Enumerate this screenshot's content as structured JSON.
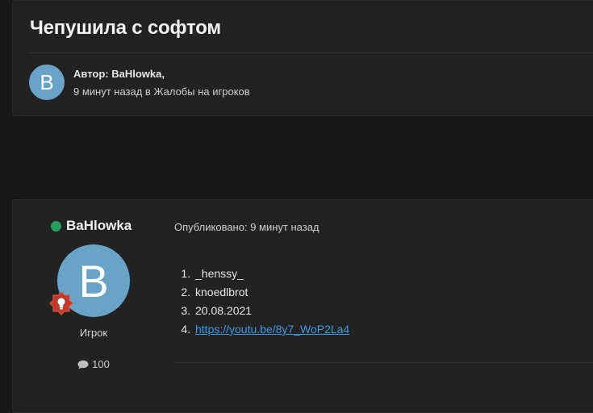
{
  "topic": {
    "title": "Чепушила с софтом",
    "author_line": "Автор: BaHlowka,",
    "sub_line": "9 минут назад в Жалобы на игроков",
    "avatar_letter": "B"
  },
  "post": {
    "author": "BaHlowka",
    "avatar_letter": "B",
    "rank": "Игрок",
    "post_count": "100",
    "published": "Опубликовано: 9 минут назад",
    "items": [
      "_henssy_",
      "knoedlbrot",
      "20.08.2021",
      "https://youtu.be/8y7_WoP2La4"
    ]
  },
  "colors": {
    "avatar": "#6aa3c8",
    "online": "#2a9d5c",
    "link": "#3d9be9",
    "badge": "#c0392b"
  },
  "icons": [
    "online-status-icon",
    "rank-badge-icon",
    "comment-icon"
  ]
}
